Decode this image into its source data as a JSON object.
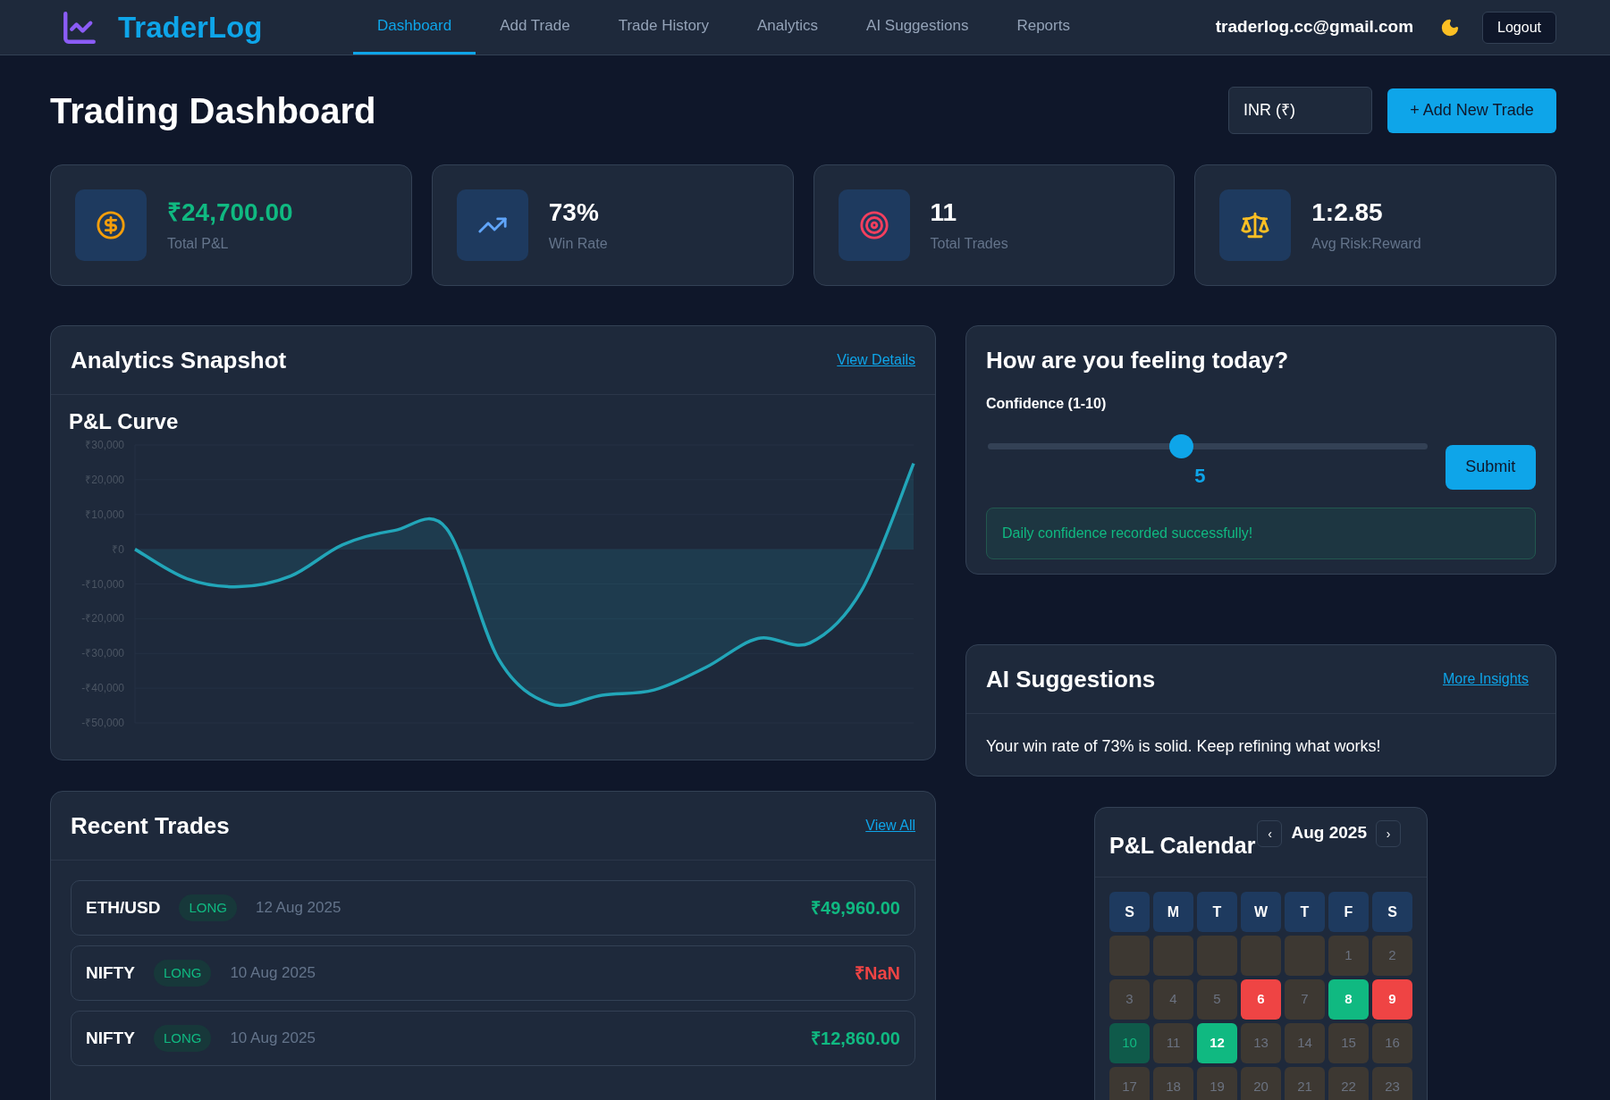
{
  "header": {
    "brand": "TraderLog",
    "nav": [
      {
        "label": "Dashboard",
        "selected": true
      },
      {
        "label": "Add Trade",
        "selected": false
      },
      {
        "label": "Trade History",
        "selected": false
      },
      {
        "label": "Analytics",
        "selected": false
      },
      {
        "label": "AI Suggestions",
        "selected": false
      },
      {
        "label": "Reports",
        "selected": false
      }
    ],
    "email": "traderlog.cc@gmail.com",
    "logout": "Logout"
  },
  "page": {
    "title": "Trading Dashboard",
    "currency": "INR (₹)",
    "add_button": "+ Add New Trade"
  },
  "stats": [
    {
      "value": "₹24,700.00",
      "label": "Total P&L",
      "kind": "positive"
    },
    {
      "value": "73%",
      "label": "Win Rate",
      "kind": "plain"
    },
    {
      "value": "11",
      "label": "Total Trades",
      "kind": "plain"
    },
    {
      "value": "1:2.85",
      "label": "Avg Risk:Reward",
      "kind": "plain"
    }
  ],
  "analytics": {
    "title": "Analytics Snapshot",
    "link": "View Details",
    "chart_data": {
      "type": "area",
      "title": "P&L Curve",
      "grid": true,
      "values": [
        0,
        -8500,
        -10800,
        -7700,
        1300,
        5400,
        6000,
        -31500,
        -44500,
        -42000,
        -40500,
        -34000,
        -25700,
        -27000,
        -11800,
        24700
      ],
      "ylim": [
        -50000,
        30000
      ],
      "yticks": [
        {
          "value": 30000,
          "label": "₹30,000"
        },
        {
          "value": 20000,
          "label": "₹20,000"
        },
        {
          "value": 10000,
          "label": "₹10,000"
        },
        {
          "value": 0,
          "label": "₹0"
        },
        {
          "value": -10000,
          "label": "-₹10,000"
        },
        {
          "value": -20000,
          "label": "-₹20,000"
        },
        {
          "value": -30000,
          "label": "-₹30,000"
        },
        {
          "value": -40000,
          "label": "-₹40,000"
        },
        {
          "value": -50000,
          "label": "-₹50,000"
        }
      ]
    }
  },
  "recent_trades": {
    "title": "Recent Trades",
    "link": "View All",
    "rows": [
      {
        "symbol": "ETH/USD",
        "side": "LONG",
        "date": "12 Aug 2025",
        "amount": "₹49,960.00",
        "kind": "profit"
      },
      {
        "symbol": "NIFTY",
        "side": "LONG",
        "date": "10 Aug 2025",
        "amount": "₹NaN",
        "kind": "loss"
      },
      {
        "symbol": "NIFTY",
        "side": "LONG",
        "date": "10 Aug 2025",
        "amount": "₹12,860.00",
        "kind": "profit"
      }
    ]
  },
  "mood": {
    "title": "How are you feeling today?",
    "label": "Confidence (1-10)",
    "level": 0.44,
    "reading": "5",
    "submit": "Submit",
    "message": "Daily confidence recorded successfully!"
  },
  "ai_suggestions": {
    "title": "AI Suggestions",
    "link": "More Insights",
    "text": "Your win rate of 73% is solid. Keep refining what works!"
  },
  "calendar": {
    "title": "P&L Calendar",
    "prev": "‹",
    "month": "Aug 2025",
    "next": "›",
    "weekdays": [
      "S",
      "M",
      "T",
      "W",
      "T",
      "F",
      "S"
    ],
    "cells": [
      {
        "kind": "empty"
      },
      {
        "kind": "empty"
      },
      {
        "kind": "empty"
      },
      {
        "kind": "empty"
      },
      {
        "kind": "empty"
      },
      {
        "day": "1",
        "kind": "neutral"
      },
      {
        "day": "2",
        "kind": "neutral"
      },
      {
        "day": "3",
        "kind": "neutral"
      },
      {
        "day": "4",
        "kind": "neutral"
      },
      {
        "day": "5",
        "kind": "neutral"
      },
      {
        "day": "6",
        "kind": "loss"
      },
      {
        "day": "7",
        "kind": "neutral"
      },
      {
        "day": "8",
        "kind": "profit"
      },
      {
        "day": "9",
        "kind": "loss"
      },
      {
        "day": "10",
        "kind": "today"
      },
      {
        "day": "11",
        "kind": "neutral"
      },
      {
        "day": "12",
        "kind": "profit"
      },
      {
        "day": "13",
        "kind": "neutral"
      },
      {
        "day": "14",
        "kind": "neutral"
      },
      {
        "day": "15",
        "kind": "neutral"
      },
      {
        "day": "16",
        "kind": "neutral"
      },
      {
        "day": "17",
        "kind": "neutral"
      },
      {
        "day": "18",
        "kind": "neutral"
      },
      {
        "day": "19",
        "kind": "neutral"
      },
      {
        "day": "20",
        "kind": "neutral"
      },
      {
        "day": "21",
        "kind": "neutral"
      },
      {
        "day": "22",
        "kind": "neutral"
      },
      {
        "day": "23",
        "kind": "neutral"
      }
    ]
  }
}
